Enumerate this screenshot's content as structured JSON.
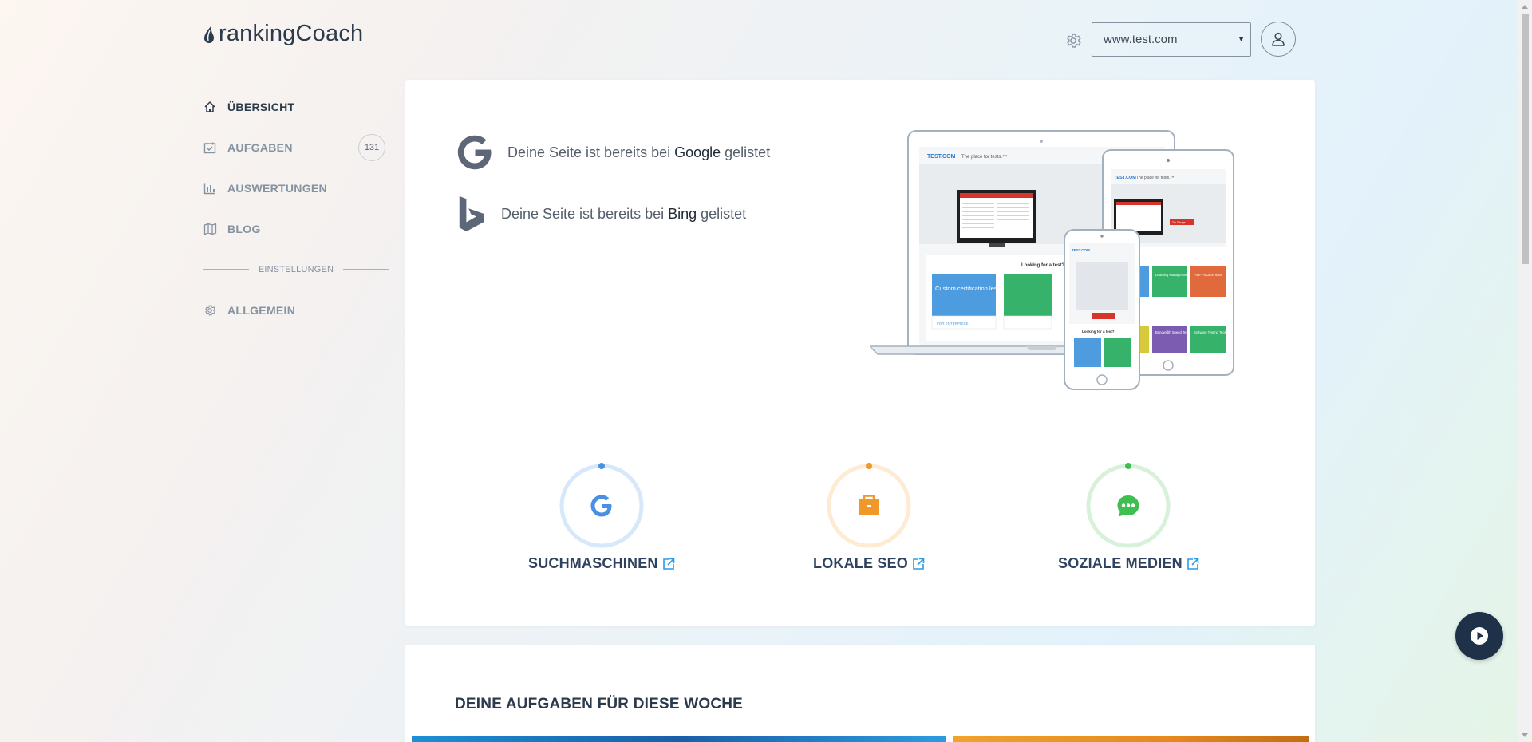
{
  "brand": {
    "name": "rankingCoach"
  },
  "header": {
    "domain_select": {
      "value": "www.test.com"
    },
    "settings_icon": "gear-icon",
    "user_icon": "user-icon"
  },
  "sidebar": {
    "items": [
      {
        "label": "ÜBERSICHT",
        "icon": "home-icon",
        "active": true
      },
      {
        "label": "AUFGABEN",
        "icon": "task-check-icon",
        "badge": "131"
      },
      {
        "label": "AUSWERTUNGEN",
        "icon": "bar-chart-icon"
      },
      {
        "label": "BLOG",
        "icon": "book-icon"
      }
    ],
    "section_label": "EINSTELLUNGEN",
    "settings_items": [
      {
        "label": "ALLGEMEIN",
        "icon": "gear-icon"
      }
    ]
  },
  "overview": {
    "listings": [
      {
        "engine": "Google",
        "prefix": "Deine Seite ist bereits bei ",
        "suffix": " gelistet",
        "icon": "google-icon"
      },
      {
        "engine": "Bing",
        "prefix": "Deine Seite ist bereits bei ",
        "suffix": " gelistet",
        "icon": "bing-icon"
      }
    ],
    "metrics": [
      {
        "label": "SUCHMASCHINEN",
        "icon": "google-icon",
        "color": "#4a90e2",
        "ring_color": "#d6e8fa"
      },
      {
        "label": "LOKALE SEO",
        "icon": "briefcase-icon",
        "color": "#f0992a",
        "ring_color": "#fdebd4"
      },
      {
        "label": "SOZIALE MEDIEN",
        "icon": "chat-bubble-icon",
        "color": "#3fbf4f",
        "ring_color": "#d8f1da"
      }
    ],
    "device_mockup": {
      "site_brand": "TEST.COM",
      "tagline": "The place for tests.™",
      "section_heading": "Looking for a test?",
      "tile_labels": [
        "Custom certification lesson and tests",
        "Learning Management Systems",
        "Free Practice Tests",
        "Bandwidth Speed Tests",
        "Software Testing Tools"
      ],
      "link_label": "FOR ENTERPRISE",
      "button_label": "Try Gauge"
    }
  },
  "tasks": {
    "title": "DEINE AUFGABEN FÜR DIESE WOCHE"
  },
  "video_button": {
    "icon": "play-icon"
  }
}
